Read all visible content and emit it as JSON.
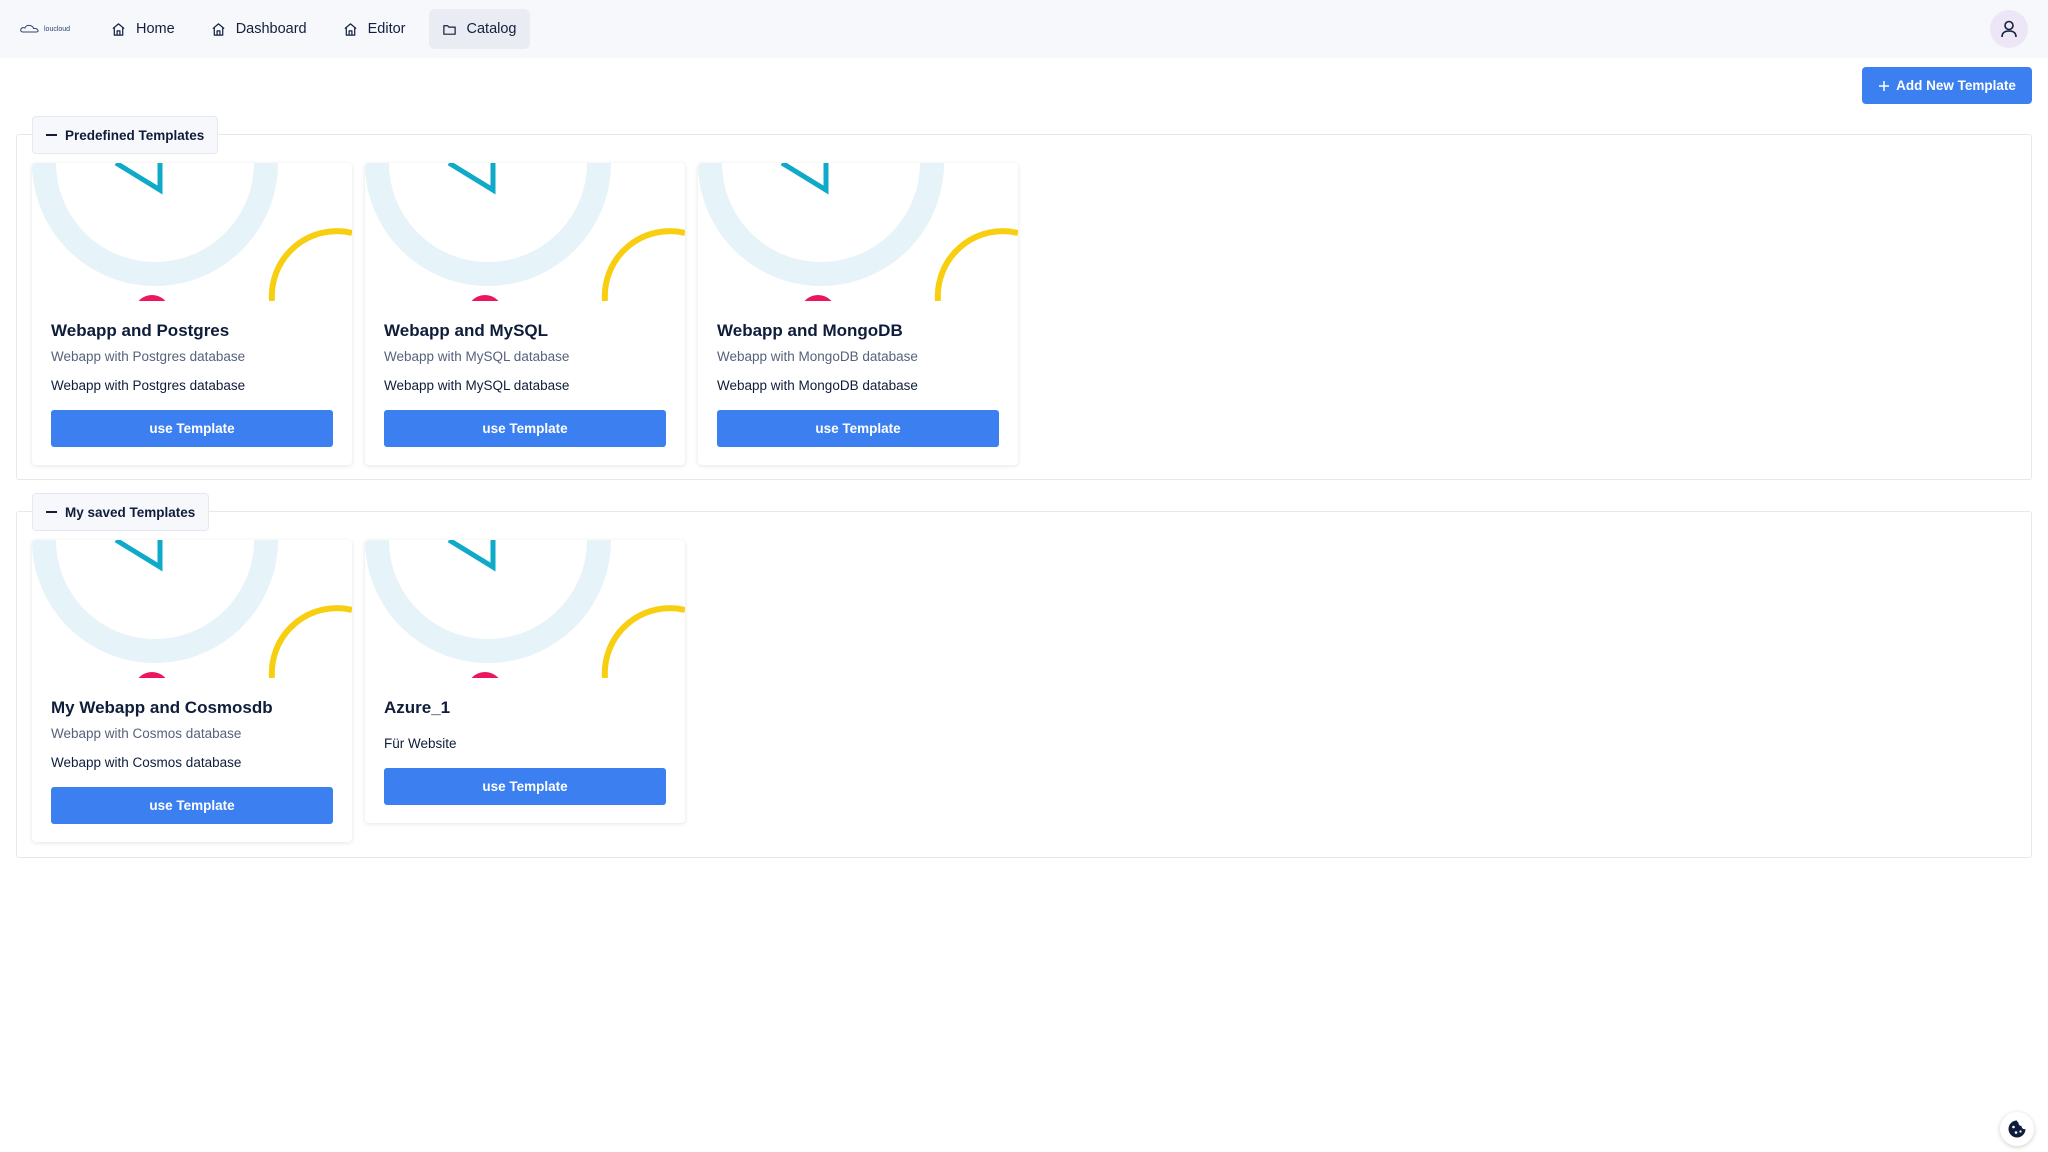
{
  "nav": {
    "logo_text": "loucloud",
    "items": [
      {
        "label": "Home",
        "icon": "home-icon"
      },
      {
        "label": "Dashboard",
        "icon": "home-icon"
      },
      {
        "label": "Editor",
        "icon": "home-icon"
      },
      {
        "label": "Catalog",
        "icon": "folder-icon",
        "active": true
      }
    ],
    "user_icon": "user-icon"
  },
  "toolbar": {
    "add_label": "Add New Template",
    "add_icon": "plus-icon"
  },
  "sections": [
    {
      "title": "Predefined Templates",
      "cards": [
        {
          "title": "Webapp and Postgres",
          "subtitle": "Webapp with Postgres database",
          "description": "Webapp with Postgres database",
          "button": "use Template"
        },
        {
          "title": "Webapp and MySQL",
          "subtitle": "Webapp with MySQL database",
          "description": "Webapp with MySQL database",
          "button": "use Template"
        },
        {
          "title": "Webapp and MongoDB",
          "subtitle": "Webapp with MongoDB database",
          "description": "Webapp with MongoDB database",
          "button": "use Template"
        }
      ]
    },
    {
      "title": "My saved Templates",
      "cards": [
        {
          "title": "My Webapp and Cosmosdb",
          "subtitle": "Webapp with Cosmos database",
          "description": "Webapp with Cosmos database",
          "button": "use Template"
        },
        {
          "title": "Azure_1",
          "subtitle": "",
          "description": "Für Website",
          "button": "use Template"
        }
      ]
    }
  ],
  "colors": {
    "primary": "#3b7ff0",
    "art_arc": "#e6f3f8",
    "art_teal": "#0eaac8",
    "art_yellow": "#f8cf10",
    "art_pink": "#ec1660"
  },
  "cookie_icon": "cookie-icon"
}
